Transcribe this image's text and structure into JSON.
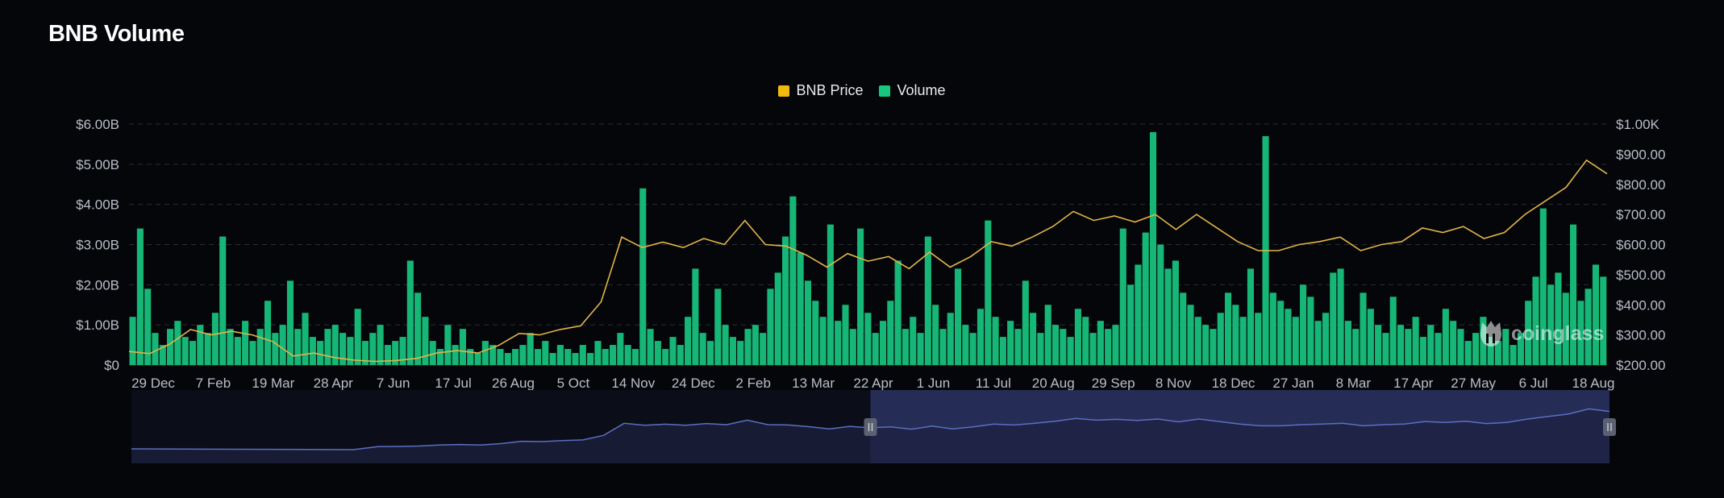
{
  "header": {
    "title": "BNB Volume"
  },
  "legend": [
    {
      "label": "BNB Price",
      "color": "#f0b90b"
    },
    {
      "label": "Volume",
      "color": "#18c67e"
    }
  ],
  "watermark": {
    "text": "coinglass",
    "icon": "coinglass-logo-icon"
  },
  "colors": {
    "background": "#05060a",
    "grid": "#2a2e36",
    "price": "#e2b54a",
    "volume": "#16b676",
    "navigator_line": "#5a6fc0",
    "navigator_fill": "#1c2140",
    "navigator_selected": "#252c55"
  },
  "chart_data": {
    "type": "bar+line",
    "title": "BNB Volume",
    "x_ticks": [
      "29 Dec",
      "7 Feb",
      "19 Mar",
      "28 Apr",
      "7 Jun",
      "17 Jul",
      "26 Aug",
      "5 Oct",
      "14 Nov",
      "24 Dec",
      "2 Feb",
      "13 Mar",
      "22 Apr",
      "1 Jun",
      "11 Jul",
      "20 Aug",
      "29 Sep",
      "8 Nov",
      "18 Dec",
      "27 Jan",
      "8 Mar",
      "17 Apr",
      "27 May",
      "6 Jul",
      "18 Aug"
    ],
    "y_left": {
      "label": "Volume",
      "ticks": [
        "$0",
        "$1.00B",
        "$2.00B",
        "$3.00B",
        "$4.00B",
        "$5.00B",
        "$6.00B"
      ],
      "range": [
        0,
        6
      ]
    },
    "y_right": {
      "label": "BNB Price",
      "ticks": [
        "$200.00",
        "$300.00",
        "$400.00",
        "$500.00",
        "$600.00",
        "$700.00",
        "$800.00",
        "$900.00",
        "$1.00K"
      ],
      "range": [
        200,
        1000
      ]
    },
    "grid": true,
    "legend_position": "top-center",
    "series": [
      {
        "name": "BNB Price",
        "axis": "right",
        "points": [
          [
            0,
            245
          ],
          [
            1,
            238
          ],
          [
            2,
            270
          ],
          [
            3,
            318
          ],
          [
            4,
            300
          ],
          [
            5,
            312
          ],
          [
            6,
            300
          ],
          [
            7,
            278
          ],
          [
            8,
            230
          ],
          [
            9,
            240
          ],
          [
            10,
            225
          ],
          [
            11,
            216
          ],
          [
            12,
            212
          ],
          [
            13,
            215
          ],
          [
            14,
            222
          ],
          [
            15,
            240
          ],
          [
            16,
            248
          ],
          [
            17,
            240
          ],
          [
            18,
            265
          ],
          [
            19,
            305
          ],
          [
            20,
            300
          ],
          [
            21,
            318
          ],
          [
            22,
            330
          ],
          [
            23,
            410
          ],
          [
            24,
            625
          ],
          [
            25,
            590
          ],
          [
            26,
            608
          ],
          [
            27,
            590
          ],
          [
            28,
            620
          ],
          [
            29,
            600
          ],
          [
            30,
            680
          ],
          [
            31,
            600
          ],
          [
            32,
            595
          ],
          [
            33,
            565
          ],
          [
            34,
            525
          ],
          [
            35,
            570
          ],
          [
            36,
            545
          ],
          [
            37,
            560
          ],
          [
            38,
            520
          ],
          [
            39,
            575
          ],
          [
            40,
            525
          ],
          [
            41,
            560
          ],
          [
            42,
            610
          ],
          [
            43,
            595
          ],
          [
            44,
            625
          ],
          [
            45,
            660
          ],
          [
            46,
            710
          ],
          [
            47,
            680
          ],
          [
            48,
            695
          ],
          [
            49,
            675
          ],
          [
            50,
            700
          ],
          [
            51,
            650
          ],
          [
            52,
            700
          ],
          [
            53,
            655
          ],
          [
            54,
            610
          ],
          [
            55,
            580
          ],
          [
            56,
            580
          ],
          [
            57,
            600
          ],
          [
            58,
            610
          ],
          [
            59,
            625
          ],
          [
            60,
            580
          ],
          [
            61,
            600
          ],
          [
            62,
            610
          ],
          [
            63,
            655
          ],
          [
            64,
            640
          ],
          [
            65,
            660
          ],
          [
            66,
            620
          ],
          [
            67,
            640
          ],
          [
            68,
            700
          ],
          [
            69,
            745
          ],
          [
            70,
            790
          ],
          [
            71,
            880
          ],
          [
            72,
            835
          ]
        ]
      },
      {
        "name": "Volume",
        "axis": "left",
        "unit": "B USD",
        "values": [
          1.2,
          3.4,
          1.9,
          0.8,
          0.5,
          0.9,
          1.1,
          0.7,
          0.6,
          1.0,
          0.8,
          1.3,
          3.2,
          0.9,
          0.7,
          1.1,
          0.6,
          0.9,
          1.6,
          0.8,
          1.0,
          2.1,
          0.9,
          1.3,
          0.7,
          0.6,
          0.9,
          1.0,
          0.8,
          0.7,
          1.4,
          0.6,
          0.8,
          1.0,
          0.5,
          0.6,
          0.7,
          2.6,
          1.8,
          1.2,
          0.6,
          0.4,
          1.0,
          0.5,
          0.9,
          0.4,
          0.3,
          0.6,
          0.5,
          0.4,
          0.3,
          0.4,
          0.5,
          0.8,
          0.4,
          0.6,
          0.3,
          0.5,
          0.4,
          0.3,
          0.5,
          0.3,
          0.6,
          0.4,
          0.5,
          0.8,
          0.5,
          0.4,
          4.4,
          0.9,
          0.6,
          0.4,
          0.7,
          0.5,
          1.2,
          2.4,
          0.8,
          0.6,
          1.9,
          1.0,
          0.7,
          0.6,
          0.9,
          1.0,
          0.8,
          1.9,
          2.3,
          3.2,
          4.2,
          2.8,
          2.1,
          1.6,
          1.2,
          3.5,
          1.1,
          1.5,
          0.9,
          3.4,
          1.3,
          0.8,
          1.1,
          1.6,
          2.6,
          0.9,
          1.2,
          0.8,
          3.2,
          1.5,
          0.9,
          1.3,
          2.4,
          1.0,
          0.8,
          1.4,
          3.6,
          1.2,
          0.7,
          1.1,
          0.9,
          2.1,
          1.3,
          0.8,
          1.5,
          1.0,
          0.9,
          0.7,
          1.4,
          1.2,
          0.8,
          1.1,
          0.9,
          1.0,
          3.4,
          2.0,
          2.5,
          3.3,
          5.8,
          3.0,
          2.4,
          2.6,
          1.8,
          1.5,
          1.2,
          1.0,
          0.9,
          1.3,
          1.8,
          1.5,
          1.2,
          2.4,
          1.3,
          5.7,
          1.8,
          1.6,
          1.4,
          1.2,
          2.0,
          1.7,
          1.1,
          1.3,
          2.3,
          2.4,
          1.1,
          0.9,
          1.8,
          1.4,
          1.0,
          0.8,
          1.7,
          1.0,
          0.9,
          1.2,
          0.7,
          1.0,
          0.8,
          1.4,
          1.1,
          0.9,
          0.6,
          0.8,
          1.2,
          0.7,
          0.6,
          0.9,
          0.5,
          0.8,
          1.6,
          2.2,
          3.9,
          2.0,
          2.3,
          1.8,
          3.5,
          1.6,
          1.9,
          2.5,
          2.2
        ]
      }
    ],
    "navigator": {
      "selected_range_fraction": [
        0.5,
        1.0
      ],
      "handle_icon": "drag-handle-icon"
    }
  }
}
